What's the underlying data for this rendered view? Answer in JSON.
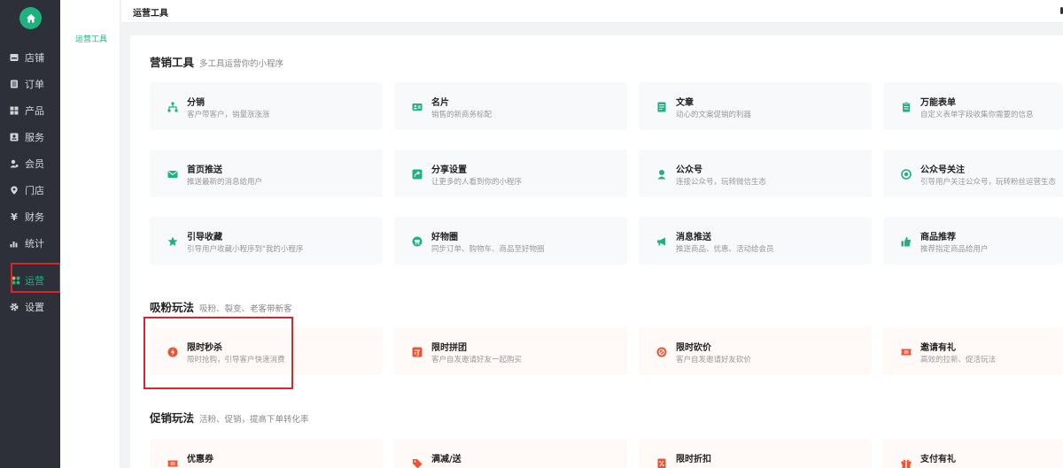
{
  "sidebar": {
    "items": [
      {
        "label": "店铺",
        "icon": "store-icon"
      },
      {
        "label": "订单",
        "icon": "order-icon"
      },
      {
        "label": "产品",
        "icon": "product-icon"
      },
      {
        "label": "服务",
        "icon": "service-icon"
      },
      {
        "label": "会员",
        "icon": "member-icon"
      },
      {
        "label": "门店",
        "icon": "location-icon"
      },
      {
        "label": "财务",
        "icon": "yen-icon"
      },
      {
        "label": "统计",
        "icon": "chart-icon"
      },
      {
        "label": "运营",
        "icon": "operation-icon"
      },
      {
        "label": "设置",
        "icon": "gear-icon"
      }
    ]
  },
  "subbar": {
    "active_item": "运营工具"
  },
  "header": {
    "title": "运营工具"
  },
  "colors": {
    "accent": "#1fb281",
    "sidebar_bg": "#2d3038",
    "highlight_red": "#d9262c"
  },
  "sections": [
    {
      "title": "营销工具",
      "desc": "多工具运营你的小程序",
      "cards": [
        {
          "name": "分销",
          "desc": "客户带客户，销量涨涨涨",
          "icon": "distribution-icon"
        },
        {
          "name": "名片",
          "desc": "销售的新商务标配",
          "icon": "business-card-icon"
        },
        {
          "name": "文章",
          "desc": "动心的文案促销的利器",
          "icon": "article-icon"
        },
        {
          "name": "万能表单",
          "desc": "自定义表单字段收集你需要的信息",
          "icon": "form-icon"
        },
        {
          "name": "首页推送",
          "desc": "推送最新的消息给用户",
          "icon": "mail-icon"
        },
        {
          "name": "分享设置",
          "desc": "让更多的人看到你的小程序",
          "icon": "share-icon"
        },
        {
          "name": "公众号",
          "desc": "连接公众号，玩转微信生态",
          "icon": "official-account-icon"
        },
        {
          "name": "公众号关注",
          "desc": "引导用户关注公众号，玩转粉丝运营生态",
          "icon": "target-icon"
        },
        {
          "name": "引导收藏",
          "desc": "引导用户收藏小程序到\"我的小程序",
          "icon": "star-icon"
        },
        {
          "name": "好物圈",
          "desc": "同步订单、购物车、商品至好物圈",
          "icon": "goods-circle-icon"
        },
        {
          "name": "消息推送",
          "desc": "推送商品、优惠、活动给会员",
          "icon": "megaphone-icon"
        },
        {
          "name": "商品推荐",
          "desc": "推荐指定商品给用户",
          "icon": "thumbs-up-icon"
        }
      ]
    },
    {
      "title": "吸粉玩法",
      "desc": "吸粉、裂变、老客带新客",
      "cards": [
        {
          "name": "限时秒杀",
          "desc": "限时抢购，引导客户快速消费",
          "icon": "flash-sale-icon"
        },
        {
          "name": "限时拼团",
          "desc": "客户自发邀请好友一起购买",
          "icon": "group-buy-icon"
        },
        {
          "name": "限时砍价",
          "desc": "客户自发邀请好友砍价",
          "icon": "bargain-icon"
        },
        {
          "name": "邀请有礼",
          "desc": "高效的拉新、促活玩法",
          "icon": "invite-icon"
        }
      ]
    },
    {
      "title": "促销玩法",
      "desc": "活粉、促销，提高下单转化率",
      "cards": [
        {
          "name": "优惠券",
          "desc": "",
          "icon": "coupon-icon"
        },
        {
          "name": "满减/送",
          "desc": "",
          "icon": "tag-icon"
        },
        {
          "name": "限时折扣",
          "desc": "",
          "icon": "discount-icon"
        },
        {
          "name": "支付有礼",
          "desc": "",
          "icon": "gift-icon"
        }
      ]
    }
  ]
}
